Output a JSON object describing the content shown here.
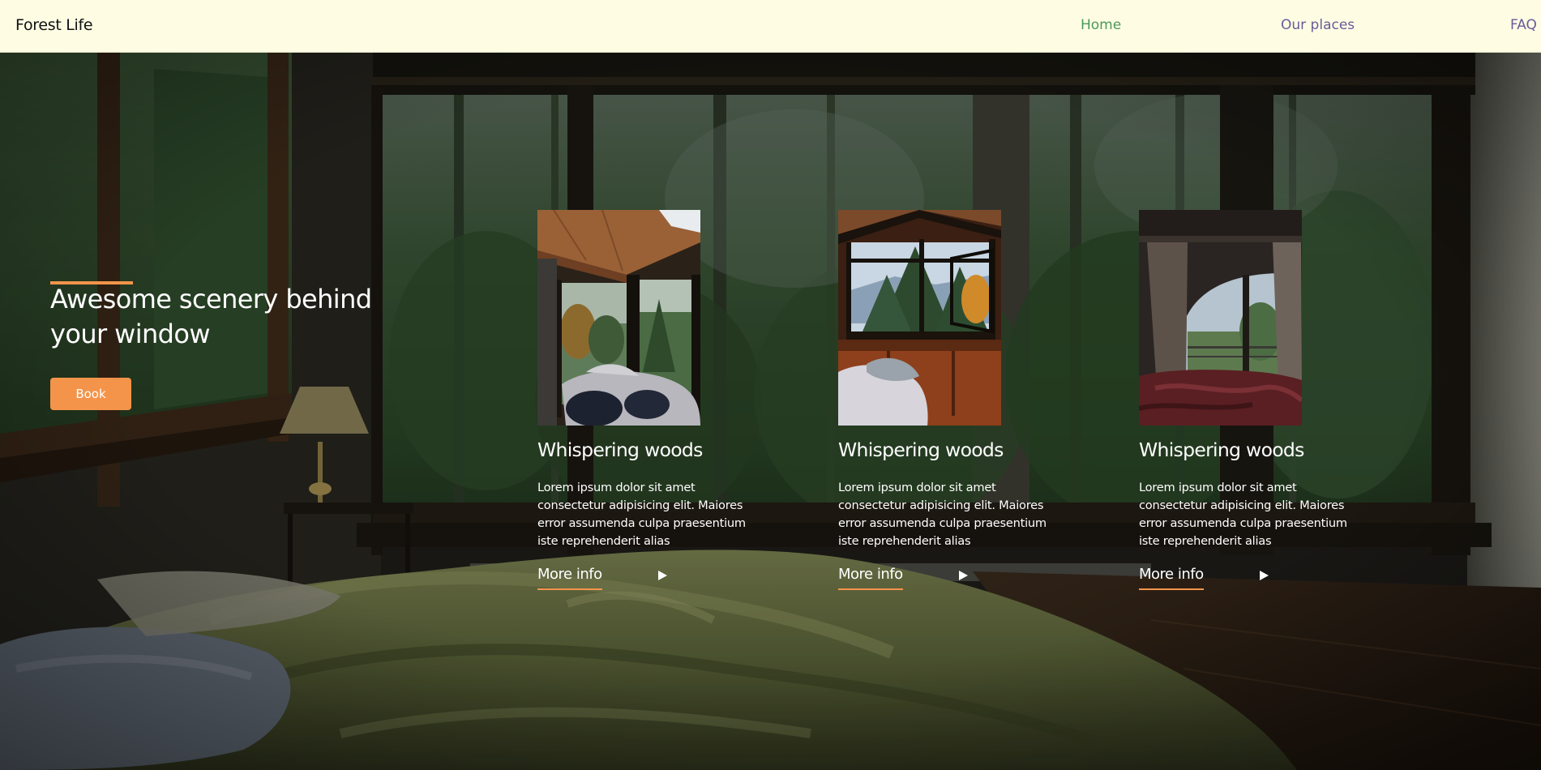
{
  "header": {
    "brand": "Forest Life",
    "nav": [
      {
        "label": "Home",
        "color": "#4c9a58",
        "active": true
      },
      {
        "label": "Our places",
        "color": "#6a5b98"
      },
      {
        "label": "FAQ",
        "color": "#6a5b98"
      }
    ],
    "background": "#fefde4"
  },
  "hero": {
    "title": "Awesome scenery behind your window",
    "book_label": "Book",
    "accent_color": "#f4944a"
  },
  "cards": [
    {
      "title": "Whispering woods",
      "text": "Lorem ipsum dolor sit amet consectetur adipisicing elit. Maiores error assumenda culpa praesentium iste reprehenderit alias",
      "more_label": "More info"
    },
    {
      "title": "Whispering woods",
      "text": "Lorem ipsum dolor sit amet consectetur adipisicing elit. Maiores error assumenda culpa praesentium iste reprehenderit alias",
      "more_label": "More info"
    },
    {
      "title": "Whispering woods",
      "text": "Lorem ipsum dolor sit amet consectetur adipisicing elit. Maiores error assumenda culpa praesentium iste reprehenderit alias",
      "more_label": "More info"
    }
  ]
}
